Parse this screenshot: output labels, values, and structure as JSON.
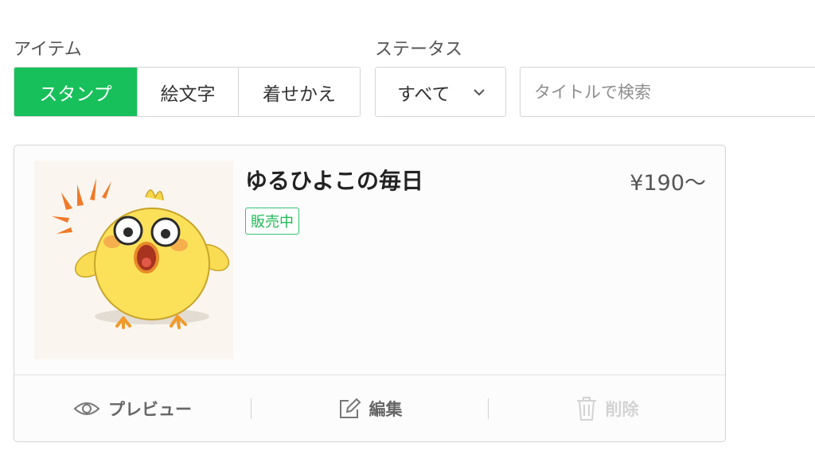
{
  "filters": {
    "item_label": "アイテム",
    "status_label": "ステータス",
    "item_tabs": [
      {
        "label": "スタンプ",
        "active": true
      },
      {
        "label": "絵文字",
        "active": false
      },
      {
        "label": "着せかえ",
        "active": false
      }
    ],
    "status_select": {
      "value": "すべて",
      "icon": "chevron-down-icon"
    },
    "search": {
      "placeholder": "タイトルで検索",
      "value": ""
    }
  },
  "card": {
    "title": "ゆるひよこの毎日",
    "price": "¥190〜",
    "status_badge": "販売中",
    "thumbnail": {
      "icon": "chick-sticker-illustration"
    },
    "actions": [
      {
        "label": "プレビュー",
        "icon": "eye-icon",
        "enabled": true
      },
      {
        "label": "編集",
        "icon": "edit-icon",
        "enabled": true
      },
      {
        "label": "削除",
        "icon": "trash-icon",
        "enabled": false
      }
    ]
  },
  "colors": {
    "accent": "#17c05a",
    "badge": "#1db954",
    "border": "#d4d4d4",
    "disabled": "#d3d3d3"
  }
}
